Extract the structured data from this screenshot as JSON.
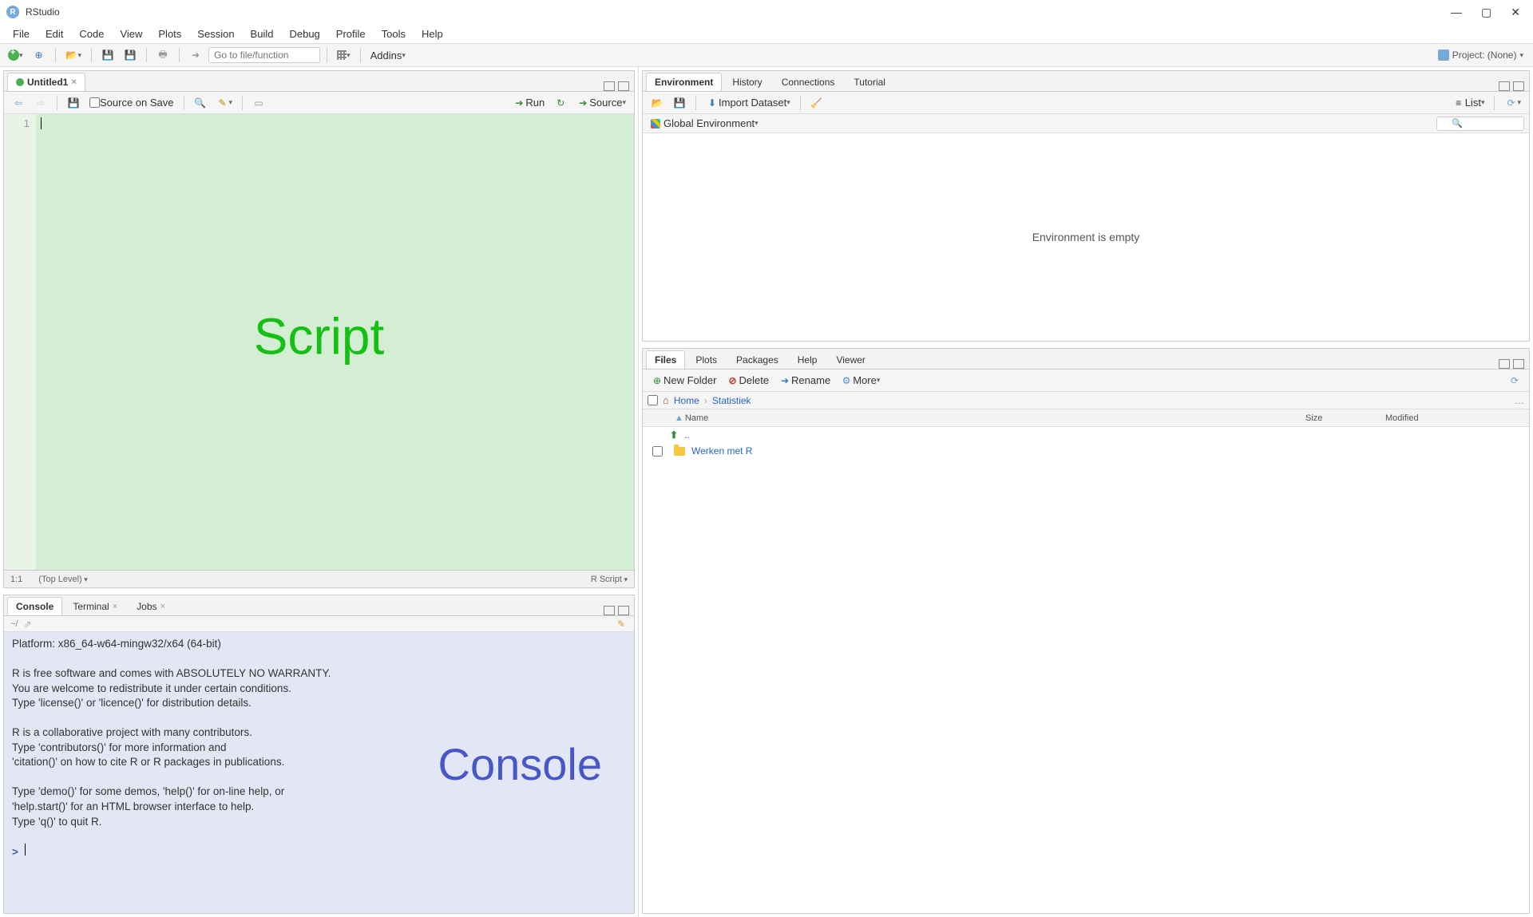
{
  "app": {
    "title": "RStudio"
  },
  "menu": [
    "File",
    "Edit",
    "Code",
    "View",
    "Plots",
    "Session",
    "Build",
    "Debug",
    "Profile",
    "Tools",
    "Help"
  ],
  "toolbar": {
    "goto_placeholder": "Go to file/function",
    "addins": "Addins",
    "project_label": "Project: (None)"
  },
  "script": {
    "tab": "Untitled1",
    "source_on_save": "Source on Save",
    "run": "Run",
    "source": "Source",
    "line_no": "1",
    "overlay": "Script",
    "status_pos": "1:1",
    "status_scope": "(Top Level)",
    "status_type": "R Script"
  },
  "console": {
    "tabs": {
      "console": "Console",
      "terminal": "Terminal",
      "jobs": "Jobs"
    },
    "path": "~/",
    "overlay": "Console",
    "text": "Platform: x86_64-w64-mingw32/x64 (64-bit)\n\nR is free software and comes with ABSOLUTELY NO WARRANTY.\nYou are welcome to redistribute it under certain conditions.\nType 'license()' or 'licence()' for distribution details.\n\nR is a collaborative project with many contributors.\nType 'contributors()' for more information and\n'citation()' on how to cite R or R packages in publications.\n\nType 'demo()' for some demos, 'help()' for on-line help, or\n'help.start()' for an HTML browser interface to help.\nType 'q()' to quit R.\n",
    "prompt": ">"
  },
  "env": {
    "tabs": {
      "environment": "Environment",
      "history": "History",
      "connections": "Connections",
      "tutorial": "Tutorial"
    },
    "import": "Import Dataset",
    "list": "List",
    "scope": "Global Environment",
    "empty": "Environment is empty"
  },
  "files": {
    "tabs": {
      "files": "Files",
      "plots": "Plots",
      "packages": "Packages",
      "help": "Help",
      "viewer": "Viewer"
    },
    "new_folder": "New Folder",
    "delete": "Delete",
    "rename": "Rename",
    "more": "More",
    "breadcrumb": {
      "home": "Home",
      "current": "Statistiek"
    },
    "cols": {
      "name": "Name",
      "size": "Size",
      "modified": "Modified"
    },
    "parent": "..",
    "item1": "Werken met R"
  }
}
